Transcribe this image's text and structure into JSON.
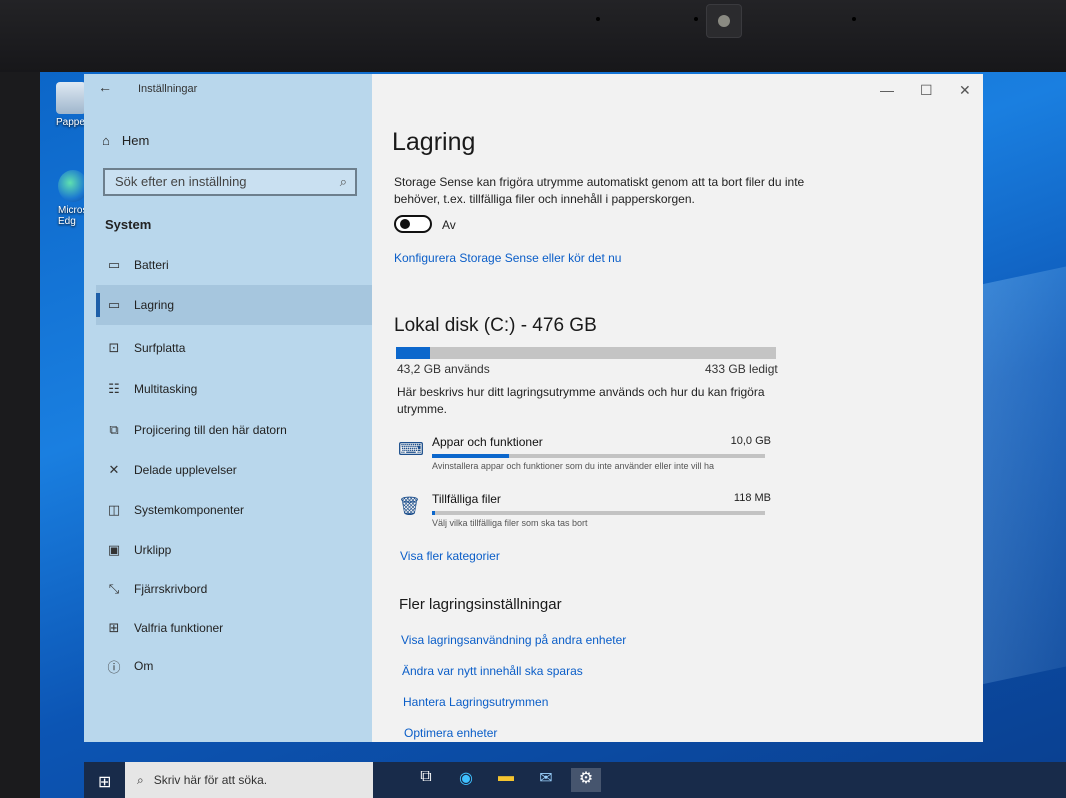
{
  "window": {
    "title": "Inställningar",
    "back_icon": "back-arrow-icon",
    "minimize": "—",
    "maximize": "☐",
    "close": "✕"
  },
  "sidebar": {
    "home_label": "Hem",
    "search_placeholder": "Sök efter en inställning",
    "section_label": "System",
    "items": [
      {
        "label": "Batteri",
        "icon": "battery-icon"
      },
      {
        "label": "Lagring",
        "icon": "storage-icon",
        "selected": true
      },
      {
        "label": "Surfplatta",
        "icon": "tablet-icon"
      },
      {
        "label": "Multitasking",
        "icon": "multitasking-icon"
      },
      {
        "label": "Projicering till den här datorn",
        "icon": "projecting-icon"
      },
      {
        "label": "Delade upplevelser",
        "icon": "shared-experiences-icon"
      },
      {
        "label": "Systemkomponenter",
        "icon": "system-components-icon"
      },
      {
        "label": "Urklipp",
        "icon": "clipboard-icon"
      },
      {
        "label": "Fjärrskrivbord",
        "icon": "remote-desktop-icon"
      },
      {
        "label": "Valfria funktioner",
        "icon": "optional-features-icon"
      },
      {
        "label": "Om",
        "icon": "info-icon"
      }
    ]
  },
  "main": {
    "title": "Lagring",
    "storage_sense_desc": "Storage Sense kan frigöra utrymme automatiskt genom att ta bort filer du inte behöver, t.ex. tillfälliga filer och innehåll i papperskorgen.",
    "toggle_label": "Av",
    "toggle_on": false,
    "configure_link": "Konfigurera Storage Sense eller kör det nu",
    "disk": {
      "title": "Lokal disk (C:) - 476 GB",
      "used": "43,2 GB används",
      "free": "433 GB ledigt",
      "used_fraction": 0.09,
      "description": "Här beskrivs hur ditt lagringsutrymme används och hur du kan frigöra utrymme."
    },
    "categories": [
      {
        "name": "Appar och funktioner",
        "size": "10,0 GB",
        "sub": "Avinstallera appar och funktioner som du inte använder eller inte vill ha",
        "fraction": 0.23,
        "icon": "apps-icon"
      },
      {
        "name": "Tillfälliga filer",
        "size": "118 MB",
        "sub": "Välj vilka tillfälliga filer som ska tas bort",
        "fraction": 0.01,
        "icon": "trash-icon"
      }
    ],
    "more_categories_link": "Visa fler kategorier",
    "more_settings_title": "Fler lagringsinställningar",
    "more_links": [
      "Visa lagringsanvändning på andra enheter",
      "Ändra var nytt innehåll ska sparas",
      "Hantera Lagringsutrymmen",
      "Optimera enheter"
    ]
  },
  "desktop": {
    "icons": [
      {
        "label": "Papperskorgen",
        "short": "Papper"
      },
      {
        "label": "Microsoft Edge",
        "short": "Micros\nEdg"
      }
    ]
  },
  "taskbar": {
    "search_placeholder": "Skriv här för att söka."
  },
  "colors": {
    "accent": "#0c67cc",
    "sidebar_bg": "#b9d7ec",
    "link": "#0b5ec8"
  }
}
